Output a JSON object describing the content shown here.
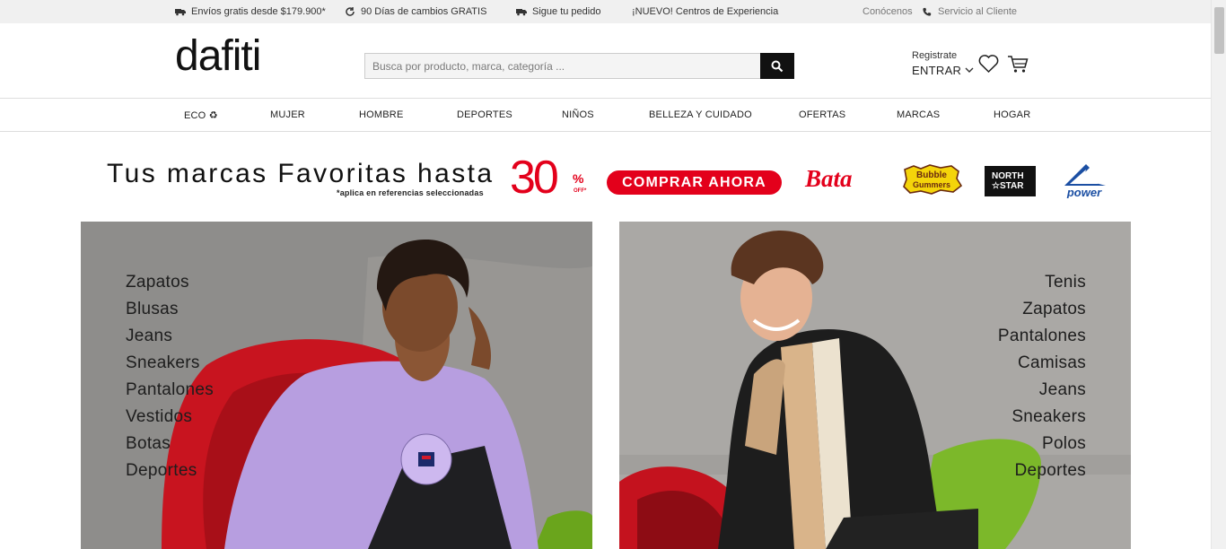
{
  "topbar": {
    "left_items": [
      {
        "icon": "truck-icon",
        "label": "Envíos gratis desde $179.900*"
      },
      {
        "icon": "refresh-icon",
        "label": "90 Días de cambios GRATIS"
      },
      {
        "icon": "truck-icon",
        "label": "Sigue tu pedido"
      },
      {
        "icon": "",
        "label": "¡NUEVO! Centros de Experiencia"
      }
    ],
    "right_items": [
      {
        "icon": "",
        "label": "Conócenos"
      },
      {
        "icon": "phone-icon",
        "label": "Servicio al Cliente"
      }
    ]
  },
  "header": {
    "logo": "dafiti",
    "search_placeholder": "Busca por producto, marca, categoría ...",
    "register_label": "Registrate",
    "login_label": "ENTRAR"
  },
  "nav": {
    "items": [
      "ECO ♻",
      "MUJER",
      "HOMBRE",
      "DEPORTES",
      "NIÑOS",
      "BELLEZA Y CUIDADO",
      "OFERTAS",
      "MARCAS",
      "HOGAR"
    ]
  },
  "promo": {
    "title": "Tus marcas Favoritas hasta",
    "note": "*aplica en referencias seleccionadas",
    "percent": "30",
    "percent_symbol": "%",
    "off": "OFF*",
    "button": "COMPRAR AHORA",
    "brands": {
      "bata": "Bata",
      "bubble": "Bubble Gummers",
      "northstar_1": "NORTH",
      "northstar_2": "☆STAR",
      "power": "power"
    },
    "accent_color": "#e3001b"
  },
  "women": {
    "links": [
      "Zapatos",
      "Blusas",
      "Jeans",
      "Sneakers",
      "Pantalones",
      "Vestidos",
      "Botas",
      "Deportes"
    ]
  },
  "men": {
    "links": [
      "Tenis",
      "Zapatos",
      "Pantalones",
      "Camisas",
      "Jeans",
      "Sneakers",
      "Polos",
      "Deportes"
    ]
  }
}
